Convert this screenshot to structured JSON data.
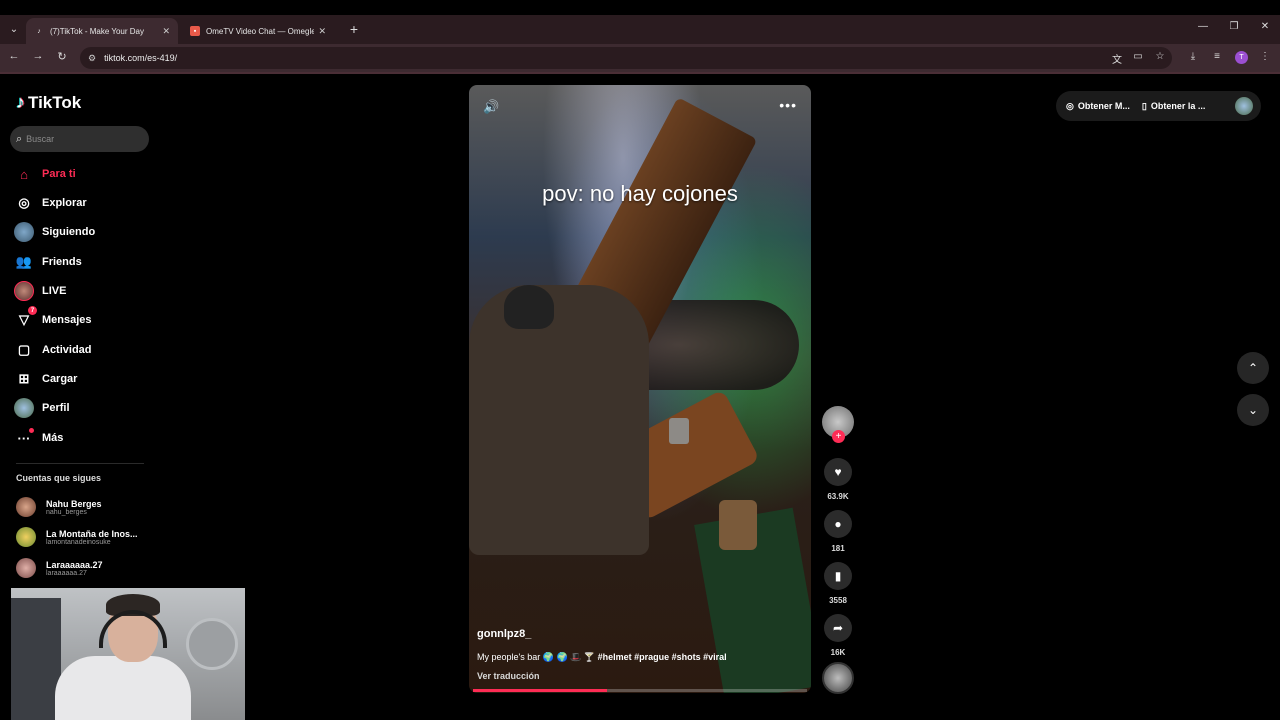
{
  "browser": {
    "tabs": [
      {
        "title": "(7)TikTok - Make Your Day",
        "active": true,
        "icon": "tiktok-icon"
      },
      {
        "title": "OmeTV Video Chat — Omegle",
        "active": false,
        "icon": "ometv-icon"
      }
    ],
    "url": "tiktok.com/es-419/"
  },
  "sidebar": {
    "logo_text": "TikTok",
    "search_placeholder": "Buscar",
    "nav": [
      {
        "label": "Para ti",
        "icon": "home-icon",
        "active": true
      },
      {
        "label": "Explorar",
        "icon": "compass-icon"
      },
      {
        "label": "Siguiendo",
        "icon": "following-avatar-icon"
      },
      {
        "label": "Friends",
        "icon": "friends-icon"
      },
      {
        "label": "LIVE",
        "icon": "live-avatar-icon"
      },
      {
        "label": "Mensajes",
        "icon": "send-icon",
        "badge": "7"
      },
      {
        "label": "Actividad",
        "icon": "inbox-icon"
      },
      {
        "label": "Cargar",
        "icon": "upload-icon"
      },
      {
        "label": "Perfil",
        "icon": "profile-avatar-icon"
      },
      {
        "label": "Más",
        "icon": "more-icon"
      }
    ],
    "following_title": "Cuentas que sigues",
    "following": [
      {
        "name": "Nahu Berges",
        "handle": "nahu_berges"
      },
      {
        "name": "La Montaña de Inos...",
        "handle": "lamontanadeinosuke"
      },
      {
        "name": "Laraaaaaa.27",
        "handle": "laraaaaaa.27"
      }
    ]
  },
  "video": {
    "overlay_text": "pov: no hay cojones",
    "author": "gonnlpz8_",
    "description_prefix": "My people's bar 🌍 🌍 🎩 🍸",
    "description_tags": "#helmet #prague #shots #viral",
    "translate_label": "Ver traducción",
    "progress": 0.4
  },
  "actions": {
    "likes": "63.9K",
    "comments": "181",
    "saves": "3558",
    "shares": "16K"
  },
  "topbar": {
    "get_coins": "Obtener M...",
    "get_app": "Obtener la ..."
  },
  "colors": {
    "accent": "#fe2c55",
    "chrome_tab": "#3d2a30",
    "chrome_strip": "#2a1b1f"
  }
}
